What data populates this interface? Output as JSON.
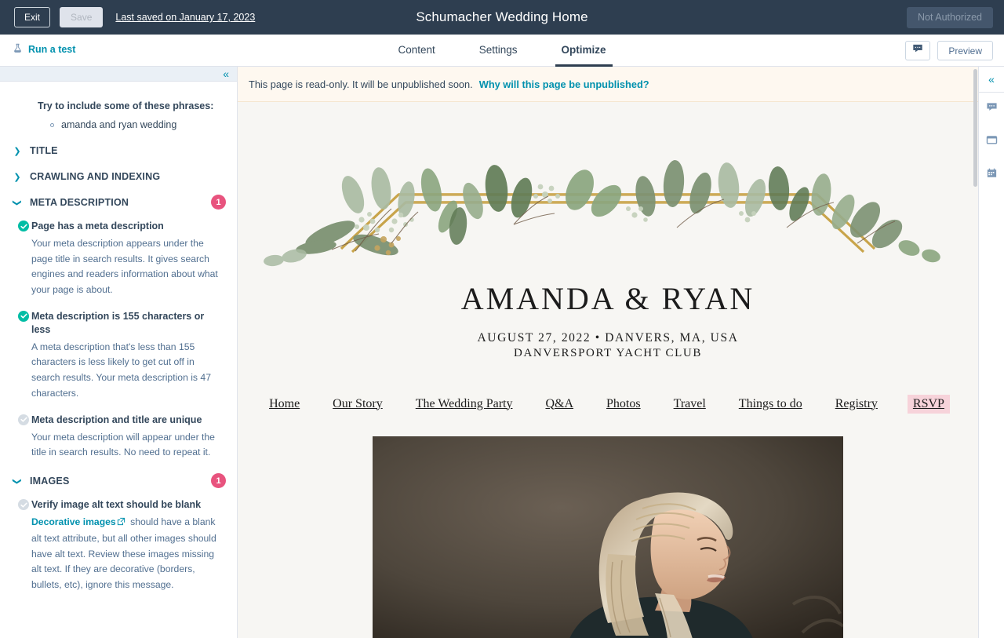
{
  "topbar": {
    "exit_label": "Exit",
    "save_label": "Save",
    "last_saved": "Last saved on January 17, 2023",
    "title": "Schumacher Wedding Home",
    "not_authorized_label": "Not Authorized"
  },
  "navbar": {
    "run_test_label": "Run a test",
    "run_test_icon": "flask-icon",
    "tabs": [
      {
        "label": "Content",
        "active": false
      },
      {
        "label": "Settings",
        "active": false
      },
      {
        "label": "Optimize",
        "active": true
      }
    ],
    "comment_icon": "comment-icon",
    "preview_label": "Preview"
  },
  "sidebar": {
    "collapse_icon": "chevron-double-left-icon",
    "phrases_heading": "Try to include some of these phrases:",
    "phrases": [
      "amanda and ryan wedding"
    ],
    "sections": [
      {
        "title": "TITLE",
        "expanded": false,
        "badge": null
      },
      {
        "title": "CRAWLING AND INDEXING",
        "expanded": false,
        "badge": null
      },
      {
        "title": "META DESCRIPTION",
        "expanded": true,
        "badge": "1"
      },
      {
        "title": "IMAGES",
        "expanded": true,
        "badge": "1"
      }
    ],
    "meta_description_items": [
      {
        "status": "done",
        "title": "Page has a meta description",
        "description": "Your meta description appears under the page title in search results. It gives search engines and readers information about what your page is about."
      },
      {
        "status": "done",
        "title": "Meta description is 155 characters or less",
        "description": "A meta description that's less than 155 characters is less likely to get cut off in search results. Your meta description is 47 characters."
      },
      {
        "status": "pending",
        "title": "Meta description and title are unique",
        "description": "Your meta description will appear under the title in search results. No need to repeat it."
      }
    ],
    "images_item": {
      "status": "pending",
      "title": "Verify image alt text should be blank",
      "link_label": "Decorative images",
      "link_icon": "external-link-icon",
      "description": " should have a blank alt text attribute, but all other images should have alt text. Review these images missing alt text. If they are decorative (borders, bullets, etc), ignore this message."
    }
  },
  "preview": {
    "banner_message": "This page is read-only. It will be unpublished soon.",
    "banner_link": "Why will this page be unpublished?",
    "site": {
      "header_graphic": "watercolor-greenery-gold-frame",
      "couple_names": "AMANDA & RYAN",
      "event_line1": "AUGUST 27, 2022 • DANVERS, MA, USA",
      "event_line2": "DANVERSPORT YACHT CLUB",
      "nav": [
        {
          "label": "Home",
          "highlighted": false
        },
        {
          "label": "Our Story",
          "highlighted": false
        },
        {
          "label": "The Wedding Party",
          "highlighted": false
        },
        {
          "label": "Q&A",
          "highlighted": false
        },
        {
          "label": "Photos",
          "highlighted": false
        },
        {
          "label": "Travel",
          "highlighted": false
        },
        {
          "label": "Things to do",
          "highlighted": false
        },
        {
          "label": "Registry",
          "highlighted": false
        },
        {
          "label": "RSVP",
          "highlighted": true
        }
      ],
      "hero_photo": "smiling-blonde-woman-portrait"
    }
  },
  "rail": {
    "collapse_icon": "chevron-double-left-icon",
    "icons": [
      "comment-icon",
      "card-icon",
      "calendar-icon"
    ]
  },
  "colors": {
    "topbar_bg": "#2e3e50",
    "accent_teal": "#0091ae",
    "badge_pink": "#e8537e",
    "check_green": "#00bda5",
    "banner_cream": "#fef8f0",
    "rsvp_pink": "#f7d3da"
  }
}
